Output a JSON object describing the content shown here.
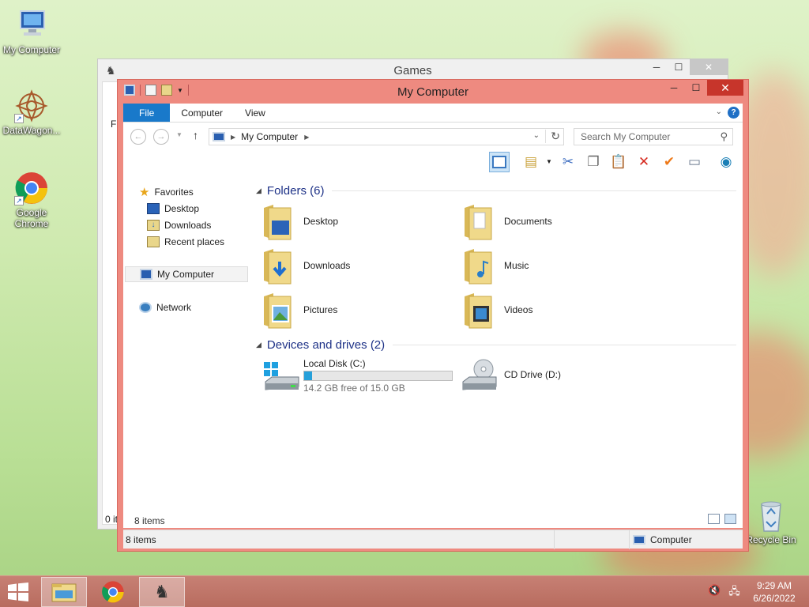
{
  "desktop": {
    "icons": [
      {
        "label": "My Computer"
      },
      {
        "label": "DataWagon..."
      },
      {
        "label": "Google Chrome"
      },
      {
        "label": "Recycle Bin"
      }
    ]
  },
  "back_window": {
    "title": "Games",
    "fragment_top": "Fi",
    "fragment_bottom": "0 it"
  },
  "window": {
    "title": "My Computer",
    "ribbon_tabs": [
      "File",
      "Computer",
      "View"
    ],
    "help_label": "?",
    "address": {
      "path": "My Computer"
    },
    "search": {
      "placeholder": "Search My Computer"
    },
    "nav": {
      "favorites": "Favorites",
      "desktop": "Desktop",
      "downloads": "Downloads",
      "recent": "Recent places",
      "computer": "My Computer",
      "network": "Network"
    },
    "folders_header": "Folders (6)",
    "folders": [
      "Desktop",
      "Documents",
      "Downloads",
      "Music",
      "Pictures",
      "Videos"
    ],
    "drives_header": "Devices and drives (2)",
    "drives": [
      {
        "name": "Local Disk (C:)",
        "free": "14.2 GB free of 15.0 GB",
        "used_fraction": 0.053
      },
      {
        "name": "CD Drive (D:)"
      }
    ],
    "items_count": "8 items",
    "status": {
      "left": "8 items",
      "right": "Computer"
    }
  },
  "taskbar": {
    "time": "9:29 AM",
    "date": "6/26/2022"
  },
  "colors": {
    "accent": "#1979ca",
    "window_frame": "#ee8a80",
    "close": "#c7352b",
    "drive_fill": "#26a0da",
    "header_text": "#1e3287"
  }
}
